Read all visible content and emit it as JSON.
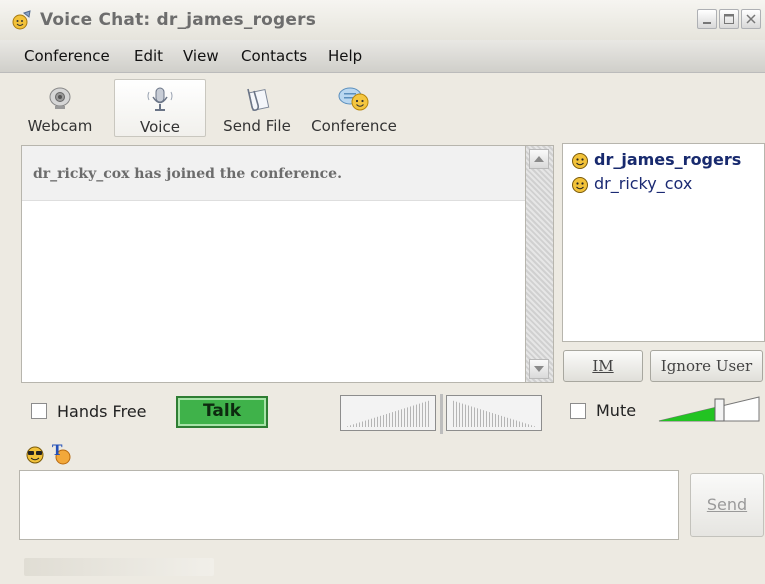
{
  "window": {
    "title": "Voice Chat:  dr_james_rogers"
  },
  "menu": [
    "Conference",
    "Edit",
    "View",
    "Contacts",
    "Help"
  ],
  "toolbar": {
    "webcam": "Webcam",
    "voice": "Voice",
    "send_file": "Send File",
    "conference": "Conference"
  },
  "chat": {
    "messages": [
      "dr_ricky_cox has joined the conference."
    ]
  },
  "participants": [
    {
      "name": "dr_james_rogers",
      "bold": true
    },
    {
      "name": "dr_ricky_cox",
      "bold": false
    }
  ],
  "buttons": {
    "im": "IM",
    "ignore_user": "Ignore User",
    "talk": "Talk",
    "send": "Send"
  },
  "controls": {
    "hands_free_label": "Hands Free",
    "hands_free_checked": false,
    "mute_label": "Mute",
    "mute_checked": false,
    "volume_level": 0.6
  },
  "colors": {
    "talk_green": "#3fb24a",
    "participant_text": "#1b2a73",
    "volume_green": "#22c322"
  },
  "icons": [
    "app-icon",
    "webcam-icon",
    "microphone-icon",
    "send-file-icon",
    "conference-icon",
    "smiley-icon",
    "emoticon-icon",
    "text-format-icon"
  ]
}
